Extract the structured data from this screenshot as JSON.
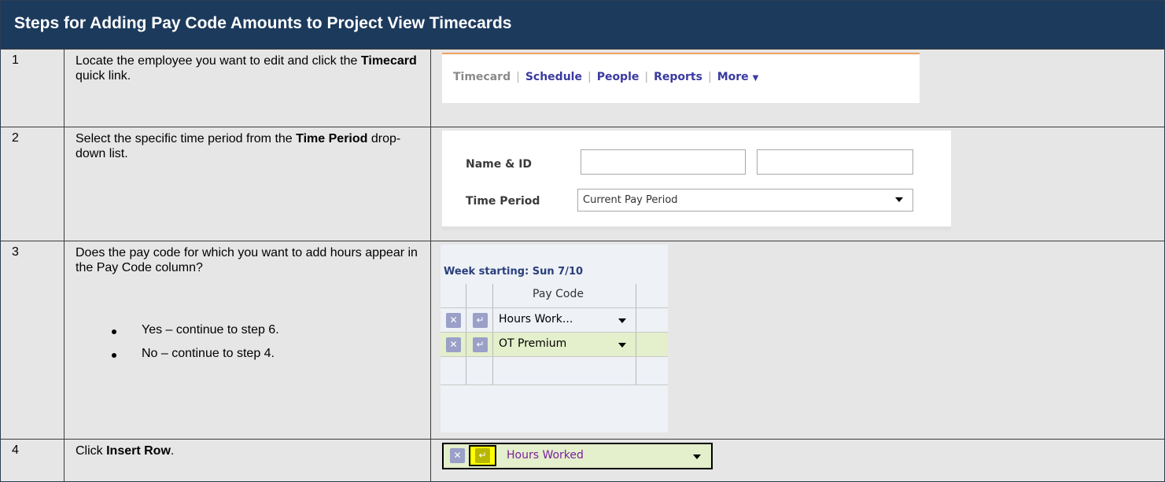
{
  "title": "Steps for Adding Pay Code Amounts to Project View Timecards",
  "steps": [
    {
      "number": "1",
      "text_before": "Locate the employee you want to edit and click the ",
      "bold": "Timecard",
      "text_after": " quick link.",
      "nav": {
        "items": [
          "Timecard",
          "Schedule",
          "People",
          "Reports",
          "More"
        ],
        "current": "Timecard"
      }
    },
    {
      "number": "2",
      "text_before": "Select the specific time period from the ",
      "bold": "Time Period",
      "text_after": " drop-down list.",
      "form": {
        "name_label": "Name & ID",
        "name_value_1": "",
        "name_value_2": "",
        "period_label": "Time Period",
        "period_value": "Current Pay Period"
      }
    },
    {
      "number": "3",
      "text": "Does the pay code for which you want to add hours appear in the Pay Code column?",
      "bullets": [
        "Yes – continue to step 6.",
        "No – continue to step 4."
      ],
      "grid": {
        "week_label": "Week starting: Sun 7/10",
        "column_header": "Pay Code",
        "rows": [
          {
            "pay_code": "Hours Work...",
            "highlight": false
          },
          {
            "pay_code": "OT Premium",
            "highlight": true
          },
          {
            "pay_code": "",
            "highlight": false
          }
        ]
      }
    },
    {
      "number": "4",
      "text_before": "Click ",
      "bold": "Insert Row",
      "text_after": ".",
      "insert_row": {
        "pay_code": "Hours Worked"
      }
    }
  ],
  "colors": {
    "header_bg": "#1c3a5c",
    "row_bg": "#e6e6e6",
    "link": "#3a3aa0",
    "highlight_row": "#e4efcb",
    "insert_highlight": "#ffff00",
    "purple_text": "#7a1fa2"
  },
  "icons": {
    "delete": "x-delete-icon",
    "insert": "insert-row-icon",
    "dropdown": "triangle-down-icon"
  }
}
